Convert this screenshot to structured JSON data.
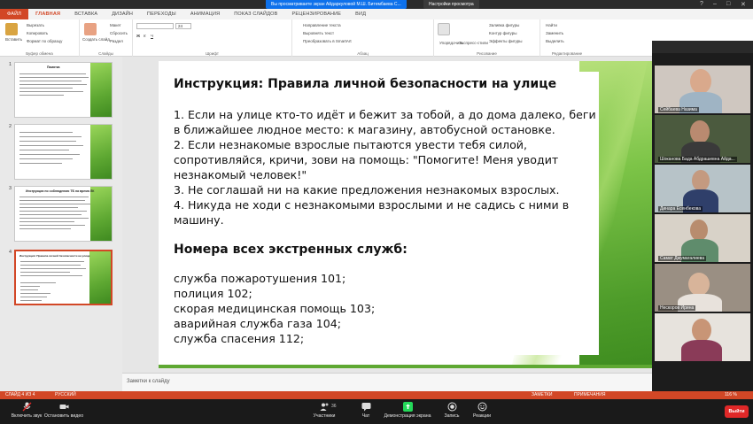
{
  "zoom_top": {
    "share_banner": "Вы просматриваете экран Айдаркуловой М.Ш. Битембаева С...",
    "view_options": "Настройки просмотра"
  },
  "ribbon": {
    "tabs": [
      "ФАЙЛ",
      "ГЛАВНАЯ",
      "ВСТАВКА",
      "ДИЗАЙН",
      "ПЕРЕХОДЫ",
      "АНИМАЦИЯ",
      "ПОКАЗ СЛАЙДОВ",
      "РЕЦЕНЗИРОВАНИЕ",
      "ВИД"
    ],
    "paste": "Вставить",
    "cut": "Вырезать",
    "copy": "Копировать",
    "format_painter": "Формат по образцу",
    "clipboard_group": "Буфер обмена",
    "new_slide": "Создать слайд",
    "layout": "Макет",
    "reset": "Сбросить",
    "section": "Раздел",
    "slides_group": "Слайды",
    "font_group": "Шрифт",
    "font_size": "24",
    "text_direction": "Направление текста",
    "align_text": "Выровнять текст",
    "convert_smartart": "Преобразовать в SmartArt",
    "paragraph_group": "Абзац",
    "arrange": "Упорядочить",
    "quick_styles": "Экспресс-стили",
    "drawing_group": "Рисование",
    "shape_fill": "Заливка фигуры",
    "shape_outline": "Контур фигуры",
    "shape_effects": "Эффекты фигуры",
    "find": "Найти",
    "replace": "Заменить",
    "select": "Выделить",
    "editing_group": "Редактирование"
  },
  "thumbnails": [
    {
      "num": "1",
      "title": "Памятка"
    },
    {
      "num": "2",
      "title": ""
    },
    {
      "num": "3",
      "title": "Инструкция по соблюдению ТБ на время ЛК"
    },
    {
      "num": "4",
      "title": "Инструкция: Правила личной безопасности на улице"
    }
  ],
  "slide": {
    "heading": "Инструкция: Правила личной безопасности на улице",
    "points": [
      "1. Если на улице кто-то идёт и бежит за тобой, а до дома далеко, беги в ближайшее людное место: к магазину, автобусной остановке.",
      "2. Если незнакомые взрослые пытаются увести тебя силой, сопротивляйся, кричи, зови на помощь: \"Помогите! Меня уводит незнакомый человек!\"",
      "3. Не соглашай ни на какие предложения незнакомых взрослых.",
      "4. Никуда не ходи с незнакомыми взрослыми и не садись с ними в машину."
    ],
    "heading2": "Номера всех экстренных служб:",
    "services": [
      "служба пожаротушения 101;",
      "полиция 102;",
      "скорая медицинская помощь 103;",
      "аварийная служба газа 104;",
      "служба спасения 112;"
    ]
  },
  "notes_placeholder": "Заметки к слайду",
  "status": {
    "slide_info": "СЛАЙД 4 ИЗ 4",
    "language": "РУССКИЙ",
    "notes": "ЗАМЕТКИ",
    "comments": "ПРИМЕЧАНИЯ",
    "zoom": "116 %"
  },
  "participants": [
    {
      "name": "Сейбаева Назима"
    },
    {
      "name": "Шоканова Бада Абдрашевна Айда..."
    },
    {
      "name": "Динара Есенбекова"
    },
    {
      "name": "Самат Джумагалиева"
    },
    {
      "name": "Нескоров Ирина"
    },
    {
      "name": ""
    }
  ],
  "zoom_bar": {
    "unmute": "Включить звук",
    "stop_video": "Остановить видео",
    "participants": "Участники",
    "participants_count": "36",
    "chat": "Чат",
    "share": "Демонстрация экрана",
    "record": "Запись",
    "reactions": "Реакции",
    "leave": "Выйти"
  },
  "colors": {
    "accent": "#d24726",
    "green": "#5ea832",
    "zoom_green": "#23d959",
    "leave_red": "#e02828"
  }
}
